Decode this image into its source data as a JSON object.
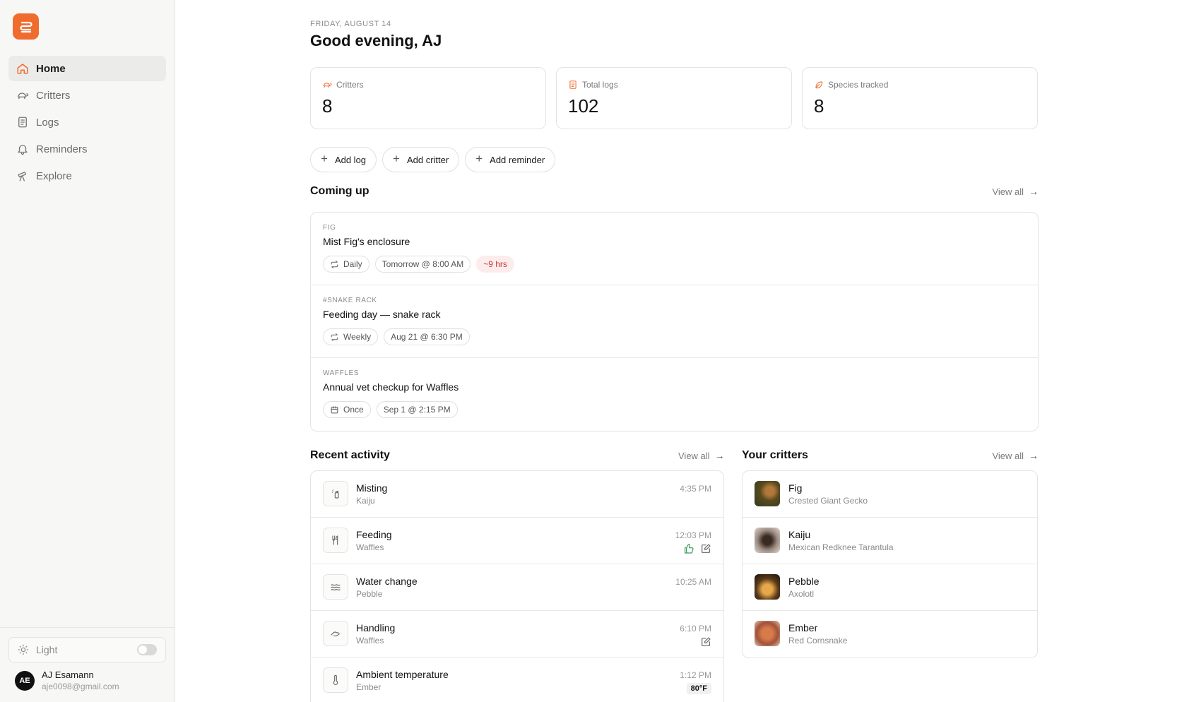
{
  "sidebar": {
    "items": [
      {
        "label": "Home",
        "icon": "home-icon"
      },
      {
        "label": "Critters",
        "icon": "turtle-icon"
      },
      {
        "label": "Logs",
        "icon": "notebook-icon"
      },
      {
        "label": "Reminders",
        "icon": "bell-icon"
      },
      {
        "label": "Explore",
        "icon": "telescope-icon"
      }
    ],
    "theme_label": "Light",
    "user": {
      "initials": "AE",
      "name": "AJ Esamann",
      "email": "aje0098@gmail.com"
    }
  },
  "header": {
    "date": "FRIDAY, AUGUST 14",
    "greeting": "Good evening, AJ"
  },
  "stats": [
    {
      "label": "Critters",
      "value": "8"
    },
    {
      "label": "Total logs",
      "value": "102"
    },
    {
      "label": "Species tracked",
      "value": "8"
    }
  ],
  "actions": {
    "add_log": "Add log",
    "add_critter": "Add critter",
    "add_reminder": "Add reminder"
  },
  "coming_up": {
    "title": "Coming up",
    "view_all": "View all",
    "items": [
      {
        "tag": "FIG",
        "title": "Mist Fig's enclosure",
        "repeat": "Daily",
        "when": "Tomorrow @ 8:00 AM",
        "due": "~9 hrs"
      },
      {
        "tag": "#SNAKE RACK",
        "title": "Feeding day — snake rack",
        "repeat": "Weekly",
        "when": "Aug 21 @ 6:30 PM"
      },
      {
        "tag": "WAFFLES",
        "title": "Annual vet checkup for Waffles",
        "repeat": "Once",
        "when": "Sep 1 @ 2:15 PM"
      }
    ]
  },
  "activity": {
    "title": "Recent activity",
    "view_all": "View all",
    "items": [
      {
        "title": "Misting",
        "critter": "Kaiju",
        "time": "4:35 PM"
      },
      {
        "title": "Feeding",
        "critter": "Waffles",
        "time": "12:03 PM"
      },
      {
        "title": "Water change",
        "critter": "Pebble",
        "time": "10:25 AM"
      },
      {
        "title": "Handling",
        "critter": "Waffles",
        "time": "6:10 PM"
      },
      {
        "title": "Ambient temperature",
        "critter": "Ember",
        "time": "1:12 PM",
        "value": "80°F"
      }
    ]
  },
  "critters": {
    "title": "Your critters",
    "view_all": "View all",
    "items": [
      {
        "name": "Fig",
        "species": "Crested Giant Gecko"
      },
      {
        "name": "Kaiju",
        "species": "Mexican Redknee Tarantula"
      },
      {
        "name": "Pebble",
        "species": "Axolotl"
      },
      {
        "name": "Ember",
        "species": "Red Cornsnake"
      }
    ]
  },
  "colors": {
    "accent": "#f06b2e",
    "due_text": "#c43a3a",
    "due_bg": "#fdecec",
    "like": "#3a9a5a"
  }
}
